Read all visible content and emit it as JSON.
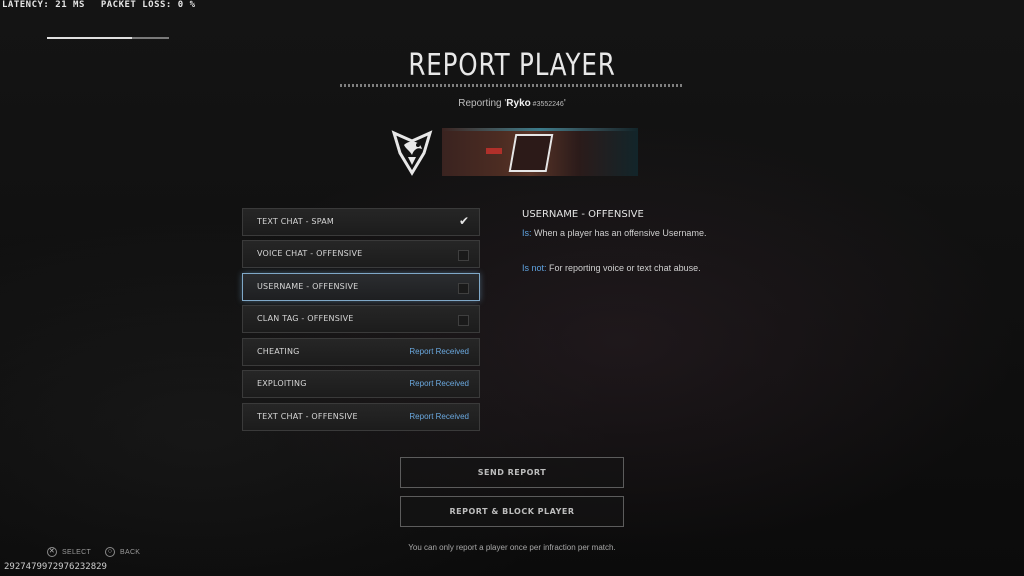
{
  "status": {
    "latency_label": "LATENCY:",
    "latency_value": "21",
    "latency_unit": "MS",
    "packet_loss_label": "PACKET LOSS:",
    "packet_loss_value": "0",
    "packet_loss_unit": "%"
  },
  "loading_progress": 0.7,
  "title": "REPORT PLAYER",
  "reporting": {
    "prefix": "Reporting '",
    "player_name": "Ryko",
    "player_tag": " #3552246",
    "suffix": "'"
  },
  "reasons": [
    {
      "label": "TEXT CHAT - SPAM",
      "state": "checked",
      "status_text": ""
    },
    {
      "label": "VOICE CHAT - OFFENSIVE",
      "state": "unchecked",
      "status_text": ""
    },
    {
      "label": "USERNAME - OFFENSIVE",
      "state": "unchecked",
      "status_text": ""
    },
    {
      "label": "CLAN TAG - OFFENSIVE",
      "state": "unchecked",
      "status_text": ""
    },
    {
      "label": "CHEATING",
      "state": "received",
      "status_text": "Report Received"
    },
    {
      "label": "EXPLOITING",
      "state": "received",
      "status_text": "Report Received"
    },
    {
      "label": "TEXT CHAT - OFFENSIVE",
      "state": "received",
      "status_text": "Report Received"
    }
  ],
  "selected_reason_index": 2,
  "description": {
    "title": "USERNAME - OFFENSIVE",
    "is_label": "Is:",
    "is_text": " When a player has an offensive Username.",
    "is_not_label": "Is not:",
    "is_not_text": " For reporting voice or text chat abuse."
  },
  "actions": {
    "send": "SEND REPORT",
    "report_block": "REPORT & BLOCK PLAYER"
  },
  "note": "You can only report a player once per infraction per match.",
  "hints": {
    "select_glyph": "✕",
    "select_label": "SELECT",
    "back_glyph": "○",
    "back_label": "BACK"
  },
  "session_id": "2927479972976232829",
  "colors": {
    "accent_blue": "#6aa8df",
    "selected_border": "#7fa8c8"
  }
}
